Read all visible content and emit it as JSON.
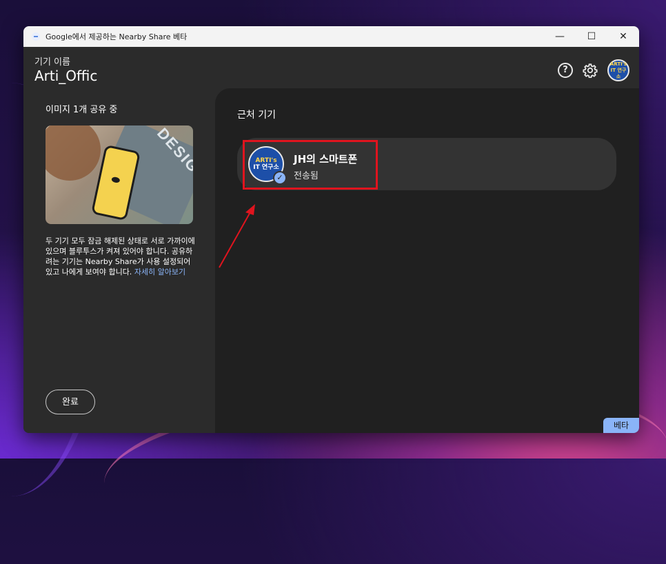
{
  "window": {
    "title": "Google에서 제공하는 Nearby Share 베타",
    "minimize": "—",
    "maximize": "☐",
    "close": "✕"
  },
  "header": {
    "device_label": "기기 이름",
    "device_name": "Arti_Offic",
    "help_glyph": "?",
    "avatar_line1": "ARTI's",
    "avatar_line2": "IT 연구소"
  },
  "left_panel": {
    "share_title": "이미지 1개 공유 중",
    "preview_word": "DESIGN",
    "description": "두 기기 모두 잠금 해제된 상태로 서로 가까이에 있으며 블루투스가 켜져 있어야 합니다. 공유하려는 기기는 Nearby Share가 사용 설정되어 있고 나에게 보여야 합니다. ",
    "learn_more": "자세히 알아보기",
    "done_button": "완료"
  },
  "right_panel": {
    "nearby_title": "근처 기기",
    "device": {
      "name": "JH의 스마트폰",
      "status": "전송됨",
      "avatar_line1": "ARTI's",
      "avatar_line2": "IT 연구소"
    },
    "beta_badge": "베타"
  },
  "colors": {
    "accent": "#8ab4f8",
    "highlight": "#e0141e",
    "window_bg": "#2b2b2b",
    "panel_bg": "#202020"
  }
}
